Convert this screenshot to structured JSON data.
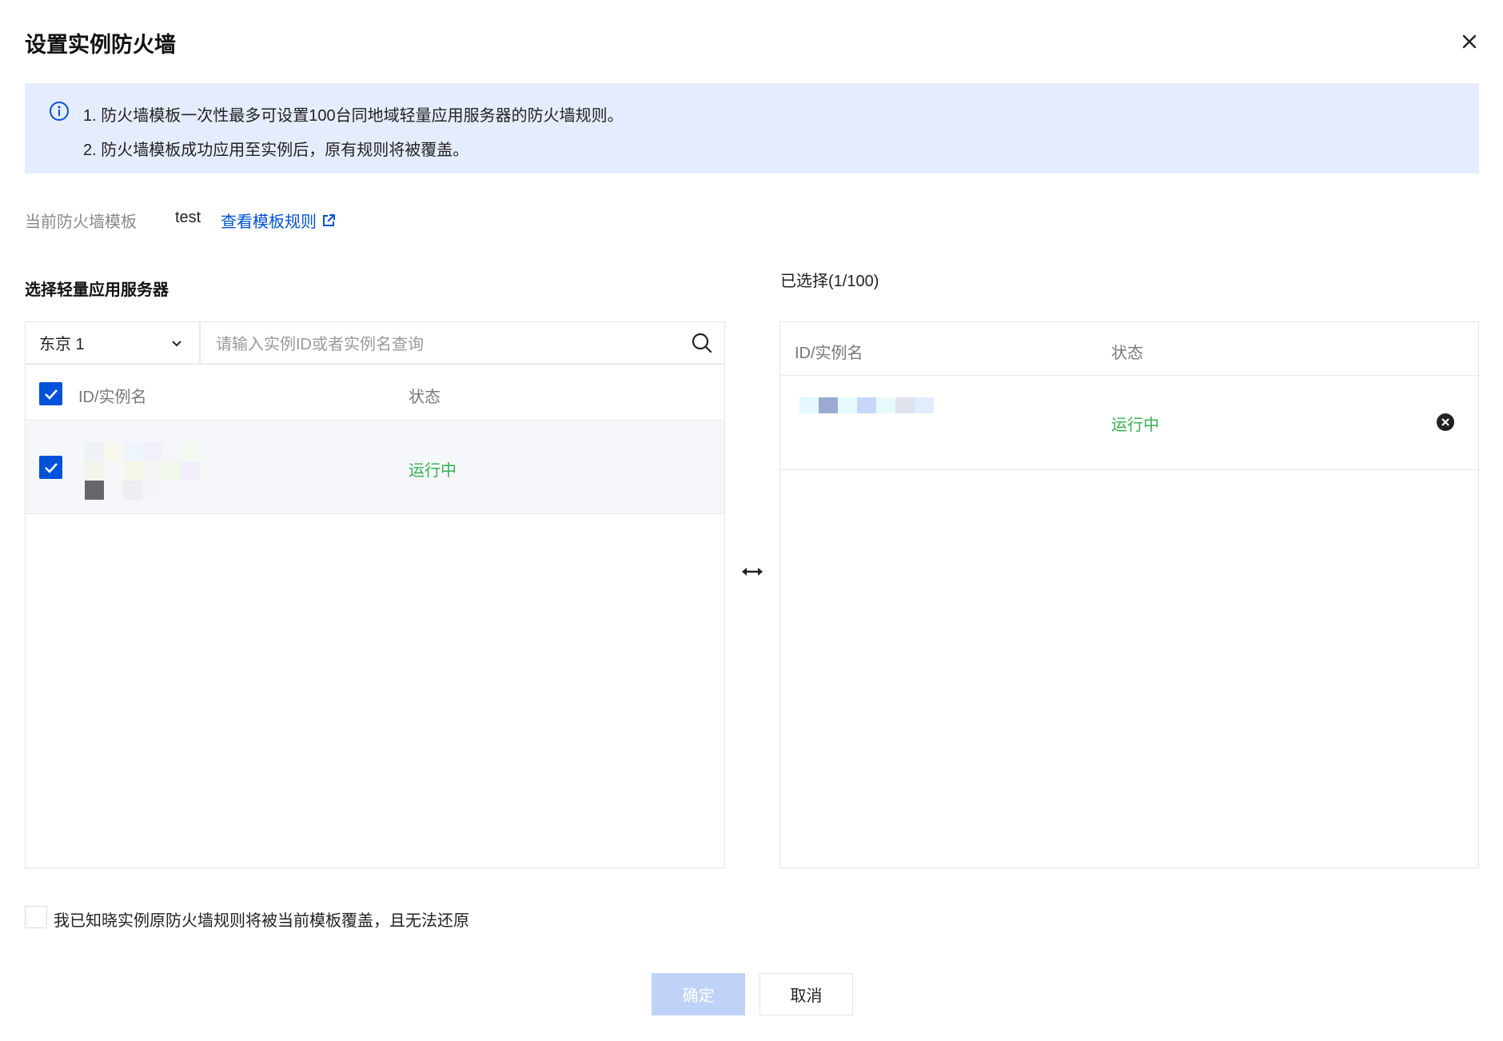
{
  "dialog": {
    "title": "设置实例防火墙",
    "close_icon": "close-icon"
  },
  "notice": {
    "icon": "info-icon",
    "lines": [
      "1. 防火墙模板一次性最多可设置100台同地域轻量应用服务器的防火墙规则。",
      "2. 防火墙模板成功应用至实例后，原有规则将被覆盖。"
    ]
  },
  "template": {
    "label": "当前防火墙模板",
    "value": "test",
    "link_label": "查看模板规则"
  },
  "left_panel": {
    "title": "选择轻量应用服务器",
    "region_select": "东京 1",
    "search_placeholder": "请输入实例ID或者实例名查询",
    "columns": [
      "ID/实例名",
      "状态"
    ],
    "rows": [
      {
        "checked": true,
        "status": "运行中"
      }
    ]
  },
  "right_panel": {
    "title": "已选择(1/100)",
    "columns": [
      "ID/实例名",
      "状态"
    ],
    "rows": [
      {
        "status": "运行中"
      }
    ]
  },
  "acknowledge": {
    "label": "我已知晓实例原防火墙规则将被当前模板覆盖，且无法还原",
    "checked": false
  },
  "footer": {
    "confirm_label": "确定",
    "cancel_label": "取消"
  },
  "colors": {
    "primary": "#0052d9",
    "running": "#34b251",
    "notice_bg": "#e5ecfd",
    "confirm_disabled": "#bfd2f8"
  }
}
